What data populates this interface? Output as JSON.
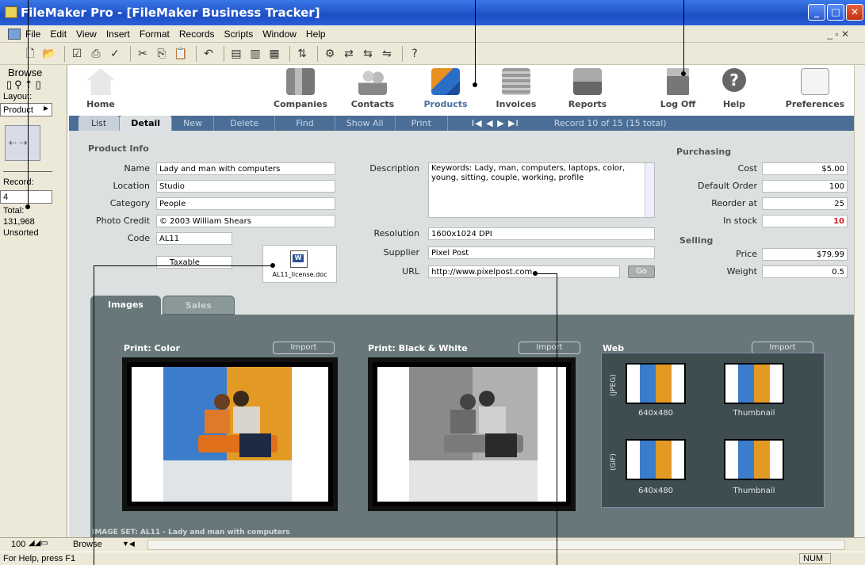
{
  "window": {
    "title": "FileMaker Pro - [FileMaker Business Tracker]"
  },
  "menu": [
    "File",
    "Edit",
    "View",
    "Insert",
    "Format",
    "Records",
    "Scripts",
    "Window",
    "Help"
  ],
  "left_panel": {
    "mode": "Browse",
    "layout_label": "Layout:",
    "layout_value": "Product",
    "record_label": "Record:",
    "record_value": "4",
    "total_label": "Total:",
    "total_value": "131,968",
    "sort_status": "Unsorted"
  },
  "nav": [
    {
      "label": "Home",
      "icon": "home-icon"
    },
    {
      "label": "Companies",
      "icon": "buildings-icon"
    },
    {
      "label": "Contacts",
      "icon": "people-icon"
    },
    {
      "label": "Products",
      "icon": "boxes-icon"
    },
    {
      "label": "Invoices",
      "icon": "coins-icon"
    },
    {
      "label": "Reports",
      "icon": "laptop-icon"
    },
    {
      "label": "Log Off",
      "icon": "lock-icon"
    },
    {
      "label": "Help",
      "icon": "help-icon"
    },
    {
      "label": "Preferences",
      "icon": "preferences-icon"
    }
  ],
  "tabs": {
    "list": "List",
    "detail": "Detail",
    "new": "New",
    "delete": "Delete",
    "find": "Find",
    "show_all": "Show All",
    "print": "Print",
    "record_nav": "I◀ ◀ ▶ ▶I",
    "record_status": "Record 10 of 15 (15 total)"
  },
  "product_info": {
    "title": "Product Info",
    "name_label": "Name",
    "name": "Lady and man with computers",
    "location_label": "Location",
    "location": "Studio",
    "category_label": "Category",
    "category": "People",
    "photo_credit_label": "Photo Credit",
    "photo_credit": "© 2003 William Shears",
    "code_label": "Code",
    "code": "AL11",
    "taxable": "Taxable",
    "doc_file": "AL11_license.doc",
    "description_label": "Description",
    "description": "Keywords: Lady, man, computers, laptops, color, young, sitting, couple, working, profile",
    "resolution_label": "Resolution",
    "resolution": "1600x1024 DPI",
    "supplier_label": "Supplier",
    "supplier": "Pixel Post",
    "url_label": "URL",
    "url": "http://www.pixelpost.com",
    "go": "Go"
  },
  "purchasing": {
    "title": "Purchasing",
    "cost_label": "Cost",
    "cost": "$5.00",
    "default_order_label": "Default Order",
    "default_order": "100",
    "reorder_label": "Reorder at",
    "reorder": "25",
    "in_stock_label": "In stock",
    "in_stock": "10"
  },
  "selling": {
    "title": "Selling",
    "price_label": "Price",
    "price": "$79.99",
    "weight_label": "Weight",
    "weight": "0.5"
  },
  "images": {
    "tab_images": "Images",
    "tab_sales": "Sales",
    "print_color": "Print: Color",
    "print_bw": "Print: Black & White",
    "web": "Web",
    "import": "Import",
    "jpeg": "(JPEG)",
    "gif": "(GIF)",
    "size_640": "640x480",
    "thumbnail": "Thumbnail",
    "image_set": "IMAGE SET: AL11 - Lady and man with computers"
  },
  "status": {
    "zoom": "100",
    "mode": "Browse",
    "help": "For Help, press F1",
    "num": "NUM"
  },
  "colors": {
    "accent": "#4a6e96",
    "panel": "#68787a",
    "stock_red": "#cc2222"
  }
}
